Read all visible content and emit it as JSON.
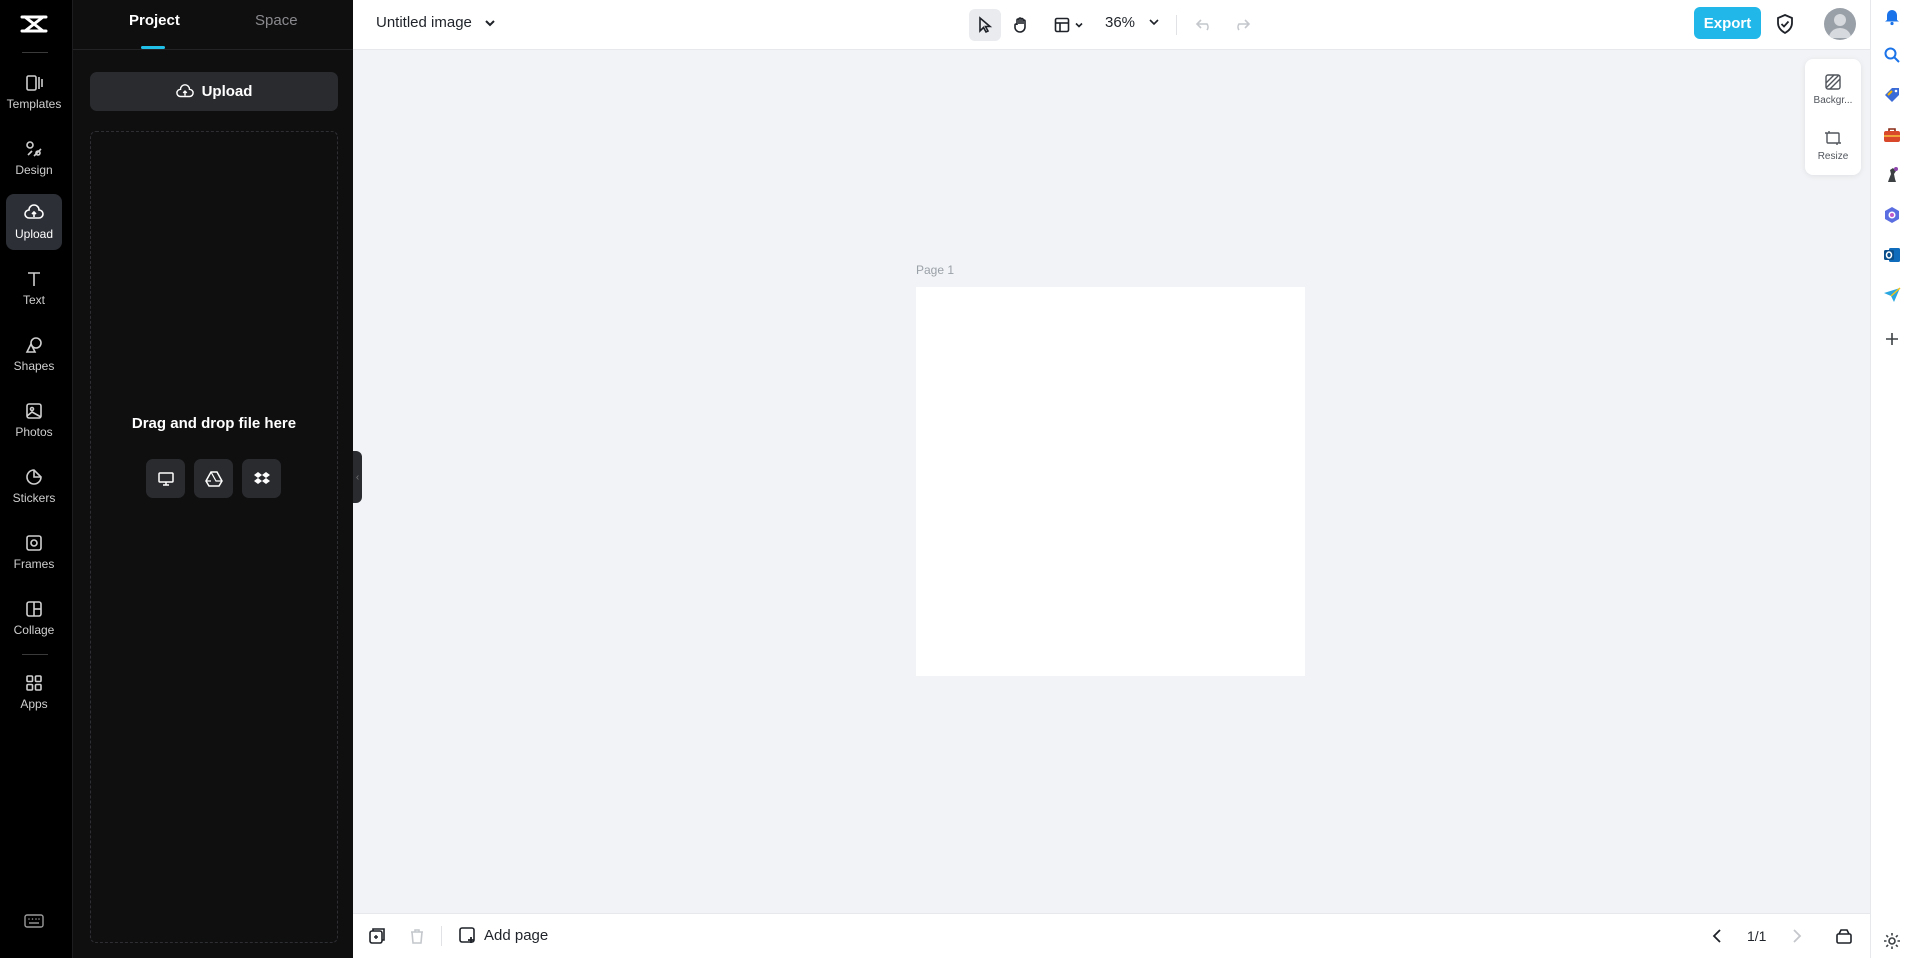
{
  "rail": {
    "items": [
      {
        "label": "Templates"
      },
      {
        "label": "Design"
      },
      {
        "label": "Upload"
      },
      {
        "label": "Text"
      },
      {
        "label": "Shapes"
      },
      {
        "label": "Photos"
      },
      {
        "label": "Stickers"
      },
      {
        "label": "Frames"
      },
      {
        "label": "Collage"
      },
      {
        "label": "Apps"
      }
    ]
  },
  "panel": {
    "tab_project": "Project",
    "tab_space": "Space",
    "upload_label": "Upload",
    "drop_text": "Drag and drop file here",
    "sources": [
      "computer-icon",
      "google-drive-icon",
      "dropbox-icon"
    ]
  },
  "topbar": {
    "title": "Untitled image",
    "zoom": "36%",
    "export_label": "Export"
  },
  "canvas": {
    "page_label": "Page 1"
  },
  "float_tools": {
    "background_label": "Backgr...",
    "resize_label": "Resize"
  },
  "bottombar": {
    "add_page_label": "Add page",
    "pager": "1/1"
  },
  "colors": {
    "accent": "#21b7e9",
    "rail_bg": "#000000",
    "panel_bg": "#0f0f10",
    "canvas_bg": "#f1f3f6"
  }
}
